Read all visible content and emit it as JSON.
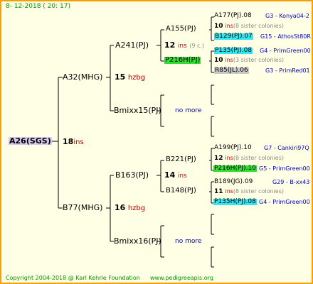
{
  "header": {
    "date": "8- 12-2018 ( 20: 17)"
  },
  "footer": {
    "copyright": "Copyright 2004-2018 @ Karl Kehrle Foundation",
    "website": "www.pedigreeapis.org"
  },
  "root": {
    "name": "A26(SGS)",
    "ins": "18",
    "ins_label": "ins"
  },
  "gen1": [
    {
      "name": "A32(MHG)",
      "ins": "15",
      "ins_label": "hzbg"
    },
    {
      "name": "B77(MHG)",
      "ins": "16",
      "ins_label": "hzbg"
    }
  ],
  "gen2": [
    {
      "name": "A241(PJ)",
      "ins": "12",
      "ins_label": "ins",
      "note": "(9 c.)"
    },
    {
      "name": "Bmixx15(PJ)",
      "note": "no more"
    },
    {
      "name": "B163(PJ)",
      "ins": "14",
      "ins_label": "ins"
    },
    {
      "name": "Bmixx16(PJ)",
      "note": "no more"
    }
  ],
  "gen3": [
    {
      "name": "A155(PJ)"
    },
    {
      "name": "P216H(PJ)"
    },
    {
      "name": "B221(PJ)"
    },
    {
      "name": "B148(PJ)"
    }
  ],
  "gen4": [
    {
      "name": "A177(PJ).08",
      "place": "G3 - Konya04-2"
    },
    {
      "ins": "10",
      "ins_label": "ins",
      "sisters": "(8 sister colonies)"
    },
    {
      "name": "B129(PJ).07",
      "place": "G15 - AthosSt80R"
    },
    {
      "name": "P135(PJ).08",
      "place": "G4 - PrimGreen00"
    },
    {
      "ins": "10",
      "ins_label": "ins",
      "sisters": "(3 sister colonies)"
    },
    {
      "name": "R85(JL).06",
      "place": "G3 - PrimRed01"
    },
    {
      "name": "A199(PJ).10",
      "place": "G7 - Cankiri97Q"
    },
    {
      "ins": "12",
      "ins_label": "ins",
      "sisters": "(8 sister colonies)"
    },
    {
      "name": "P216H(PJ).10",
      "place": "G5 - PrimGreen00"
    },
    {
      "name": "B189(JG).09",
      "place": "G29 - B-xx43"
    },
    {
      "ins": "11",
      "ins_label": "ins",
      "sisters": "(8 sister colonies)"
    },
    {
      "name": "P135H(PJ).08",
      "place": "G4 - PrimGreen00"
    }
  ],
  "colors": {
    "border": "#f5a000",
    "background": "#ffffe6",
    "highlight_cyan": "#33e6f0",
    "highlight_green": "#33dd33",
    "highlight_gray": "#c8c8c8",
    "highlight_lavender": "#d8c8f0"
  }
}
